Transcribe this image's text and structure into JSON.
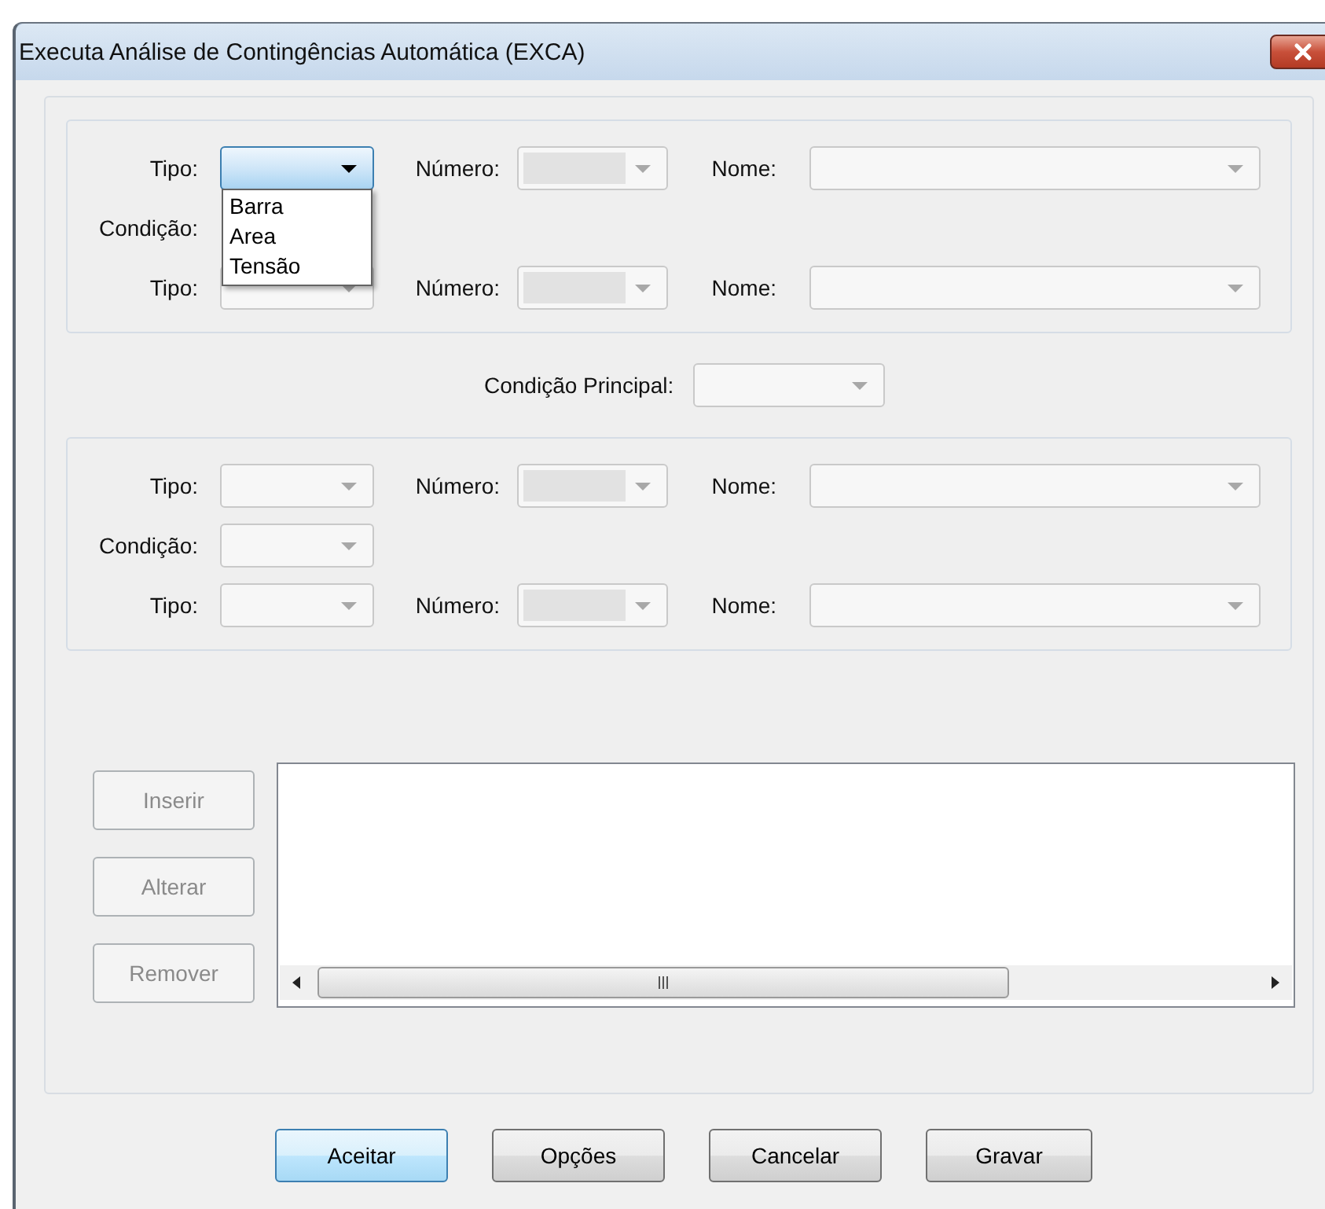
{
  "window": {
    "title": "Executa Análise de Contingências Automática (EXCA)"
  },
  "groups": [
    {
      "row1": {
        "tipo_label": "Tipo:",
        "tipo": {
          "disabled": false,
          "focused": true,
          "editable": false,
          "expanded": true,
          "options": [
            "Barra",
            "Area",
            "Tensão"
          ]
        },
        "numero_label": "Número:",
        "numero": {
          "disabled": true,
          "focused": false,
          "editable": true,
          "expanded": false
        },
        "nome_label": "Nome:",
        "nome": {
          "disabled": true,
          "focused": false,
          "editable": false,
          "expanded": false
        }
      },
      "condicao": {
        "label": "Condição:"
      },
      "row2": {
        "tipo_label": "Tipo:",
        "tipo": {
          "disabled": true,
          "focused": false,
          "editable": false,
          "expanded": false
        },
        "numero_label": "Número:",
        "numero": {
          "disabled": true,
          "focused": false,
          "editable": true,
          "expanded": false
        },
        "nome_label": "Nome:",
        "nome": {
          "disabled": true,
          "focused": false,
          "editable": false,
          "expanded": false
        }
      }
    },
    {
      "row1": {
        "tipo_label": "Tipo:",
        "tipo": {
          "disabled": true,
          "focused": false,
          "editable": false,
          "expanded": false
        },
        "numero_label": "Número:",
        "numero": {
          "disabled": true,
          "focused": false,
          "editable": true,
          "expanded": false
        },
        "nome_label": "Nome:",
        "nome": {
          "disabled": true,
          "focused": false,
          "editable": false,
          "expanded": false
        }
      },
      "condicao": {
        "label": "Condição:",
        "combo": {
          "disabled": true,
          "focused": false,
          "editable": false,
          "expanded": false
        }
      },
      "row2": {
        "tipo_label": "Tipo:",
        "tipo": {
          "disabled": true,
          "focused": false,
          "editable": false,
          "expanded": false
        },
        "numero_label": "Número:",
        "numero": {
          "disabled": true,
          "focused": false,
          "editable": true,
          "expanded": false
        },
        "nome_label": "Nome:",
        "nome": {
          "disabled": true,
          "focused": false,
          "editable": false,
          "expanded": false
        }
      }
    }
  ],
  "main_condition": {
    "label": "Condição Principal:",
    "combo": {
      "disabled": true,
      "focused": false,
      "editable": false,
      "expanded": false
    }
  },
  "list_buttons": [
    {
      "label": "Inserir",
      "disabled": true
    },
    {
      "label": "Alterar",
      "disabled": true
    },
    {
      "label": "Remover",
      "disabled": true
    }
  ],
  "buttons": [
    {
      "label": "Aceitar",
      "default": true,
      "disabled": false
    },
    {
      "label": "Opções",
      "default": false,
      "disabled": false
    },
    {
      "label": "Cancelar",
      "default": false,
      "disabled": false
    },
    {
      "label": "Gravar",
      "default": false,
      "disabled": false
    }
  ]
}
